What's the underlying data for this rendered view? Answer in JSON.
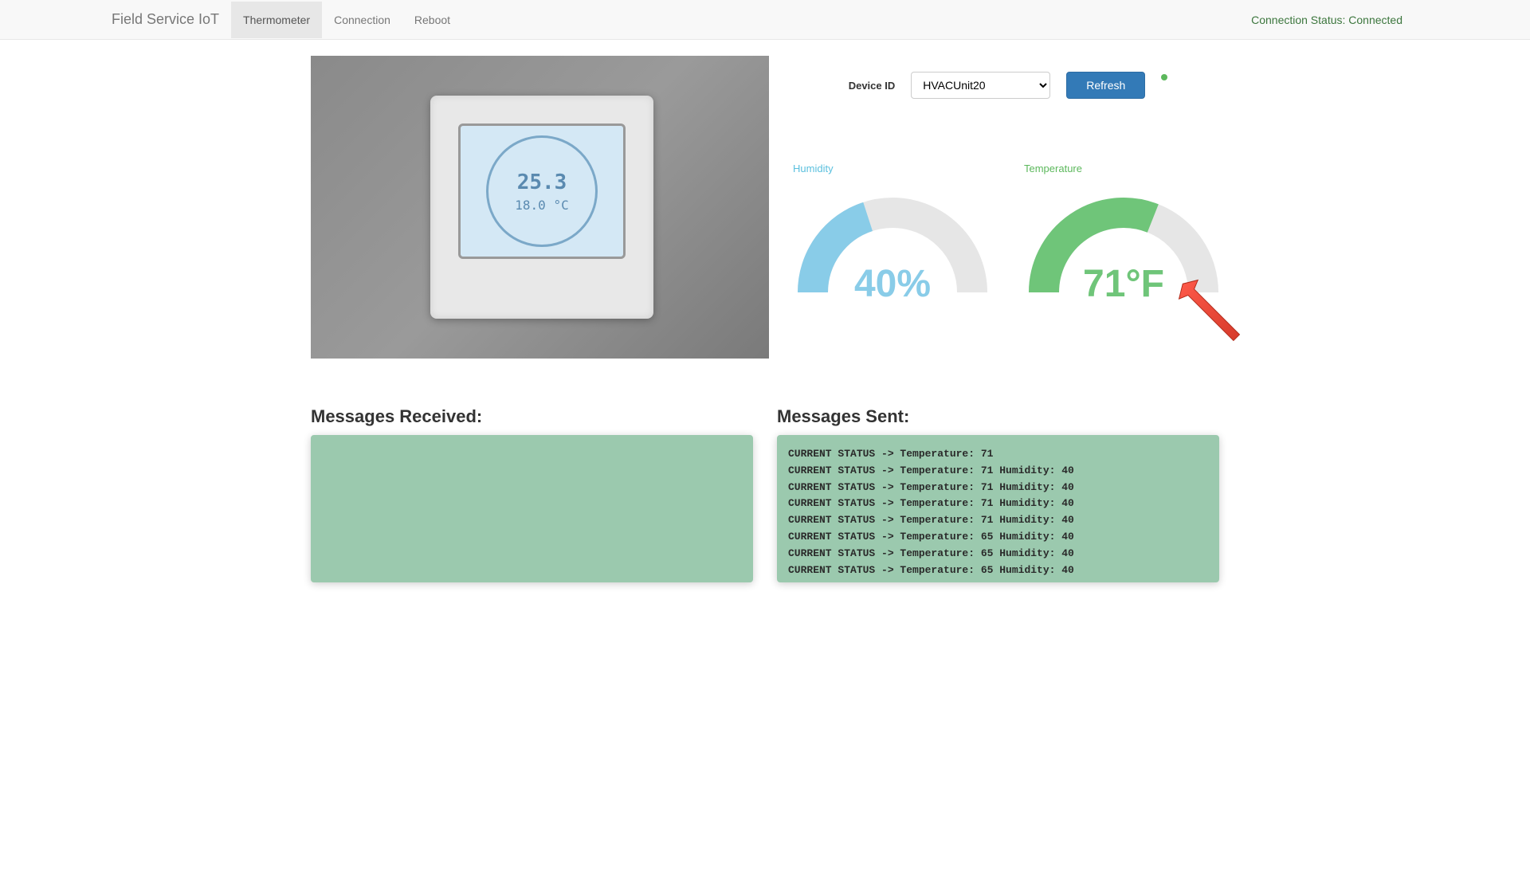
{
  "navbar": {
    "brand": "Field Service IoT",
    "tabs": [
      {
        "label": "Thermometer",
        "active": true
      },
      {
        "label": "Connection",
        "active": false
      },
      {
        "label": "Reboot",
        "active": false
      }
    ],
    "connection_status": "Connection Status: Connected"
  },
  "device_panel": {
    "device_id_label": "Device ID",
    "selected_device": "HVACUnit20",
    "refresh_label": "Refresh"
  },
  "thermostat_display": {
    "temp_primary": "25.3",
    "temp_primary_unit": "°C",
    "temp_secondary": "18.0  °C"
  },
  "gauges": {
    "humidity": {
      "title": "Humidity",
      "value": 40,
      "display": "40%",
      "color": "#89cce8"
    },
    "temperature": {
      "title": "Temperature",
      "value": 71,
      "display": "71°F",
      "fill_percent": 62,
      "color": "#6fc579"
    }
  },
  "messages_received": {
    "heading": "Messages Received:",
    "lines": []
  },
  "messages_sent": {
    "heading": "Messages Sent:",
    "lines": [
      "CURRENT STATUS -> Temperature: 71",
      "CURRENT STATUS -> Temperature: 71 Humidity: 40",
      "CURRENT STATUS -> Temperature: 71 Humidity: 40",
      "CURRENT STATUS -> Temperature: 71 Humidity: 40",
      "CURRENT STATUS -> Temperature: 71 Humidity: 40",
      "CURRENT STATUS -> Temperature: 65 Humidity: 40",
      "CURRENT STATUS -> Temperature: 65 Humidity: 40",
      "CURRENT STATUS -> Temperature: 65 Humidity: 40"
    ]
  },
  "chart_data": [
    {
      "type": "gauge",
      "title": "Humidity",
      "value": 40,
      "min": 0,
      "max": 100,
      "unit": "%"
    },
    {
      "type": "gauge",
      "title": "Temperature",
      "value": 71,
      "min": 0,
      "max": 120,
      "unit": "°F"
    }
  ]
}
